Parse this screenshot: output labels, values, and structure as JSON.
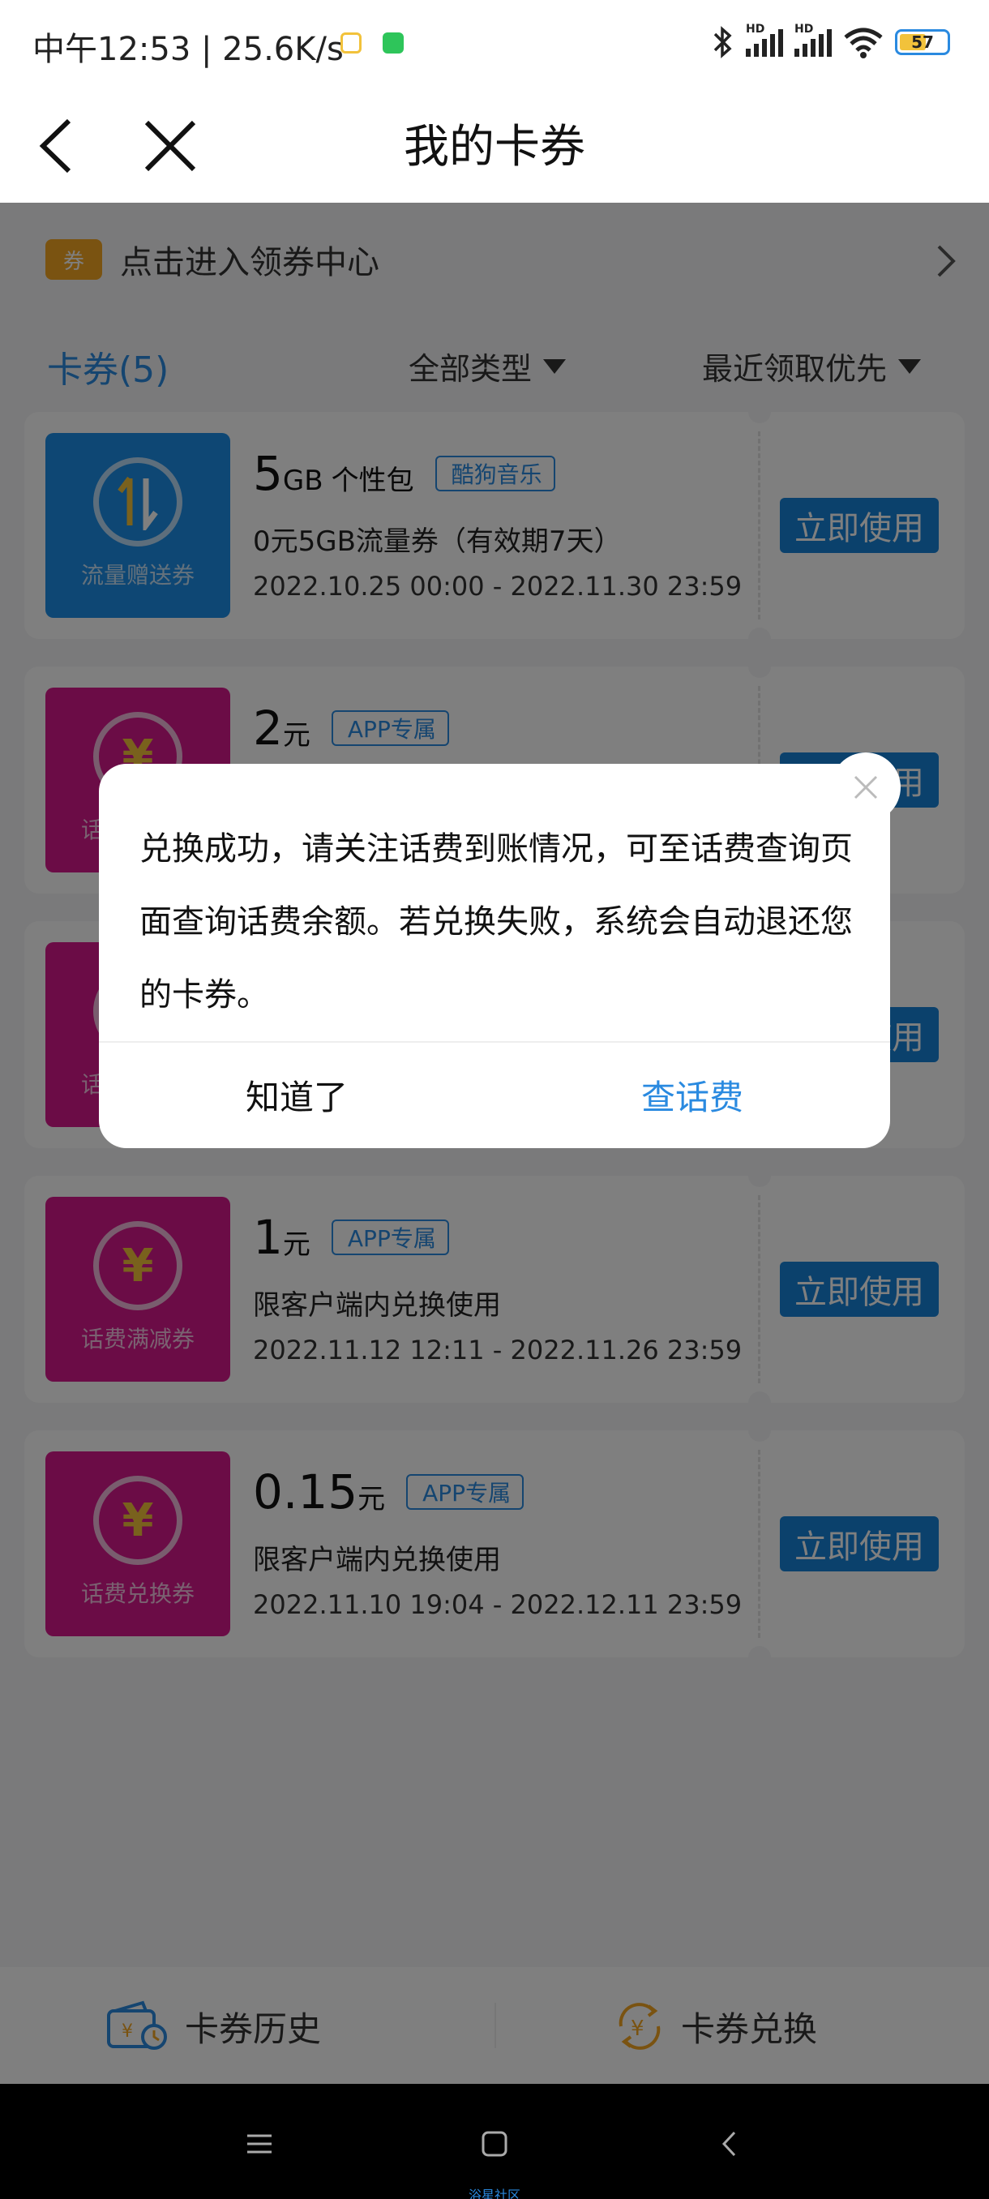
{
  "status_bar": {
    "time": "中午12:53 | 25.6K/s",
    "battery": "57",
    "hd_label": "HD",
    "icons": [
      "bluetooth-icon",
      "signal-icon",
      "signal-icon",
      "wifi-icon",
      "battery-icon"
    ]
  },
  "header": {
    "title": "我的卡券"
  },
  "coupon_center": {
    "tag": "券",
    "label": "点击进入领券中心"
  },
  "filters": {
    "tab": "卡券(5)",
    "type": "全部类型",
    "sort": "最近领取优先"
  },
  "coupons": [
    {
      "thumb_label": "流量赠送券",
      "thumb_color": "#1c8ee8",
      "amount": "5",
      "unit": "GB",
      "subtitle": "个性包",
      "tag": "酷狗音乐",
      "desc": "0元5GB流量券（有效期7天）",
      "date": "2022.10.25 00:00 - 2022.11.30 23:59",
      "button": "立即使用"
    },
    {
      "thumb_label": "话费满减券",
      "thumb_color": "#d6198c",
      "amount": "2",
      "unit": "元",
      "tag": "APP专属",
      "button": "立即使用"
    },
    {
      "thumb_label": "话费满减券",
      "thumb_color": "#d6198c",
      "button": "立即使用"
    },
    {
      "thumb_label": "话费满减券",
      "thumb_color": "#d6198c",
      "amount": "1",
      "unit": "元",
      "tag": "APP专属",
      "desc": "限客户端内兑换使用",
      "date": "2022.11.12 12:11 - 2022.11.26 23:59",
      "button": "立即使用"
    },
    {
      "thumb_label": "话费兑换券",
      "thumb_color": "#d6198c",
      "amount": "0.15",
      "unit": "元",
      "tag": "APP专属",
      "desc": "限客户端内兑换使用",
      "date": "2022.11.10 19:04 - 2022.12.11 23:59",
      "button": "立即使用"
    }
  ],
  "dialog": {
    "message": "兑换成功，请关注话费到账情况，可至话费查询页面查询话费余额。若兑换失败，系统会自动退还您的卡券。",
    "ok": "知道了",
    "check": "查话费"
  },
  "bottom_bar": {
    "history": "卡券历史",
    "exchange": "卡券兑换"
  },
  "watermark": "浴星社区",
  "colors": {
    "accent": "#2a8ae0",
    "button": "#1683d9",
    "pink": "#d6198c",
    "gold": "#f5a623"
  }
}
